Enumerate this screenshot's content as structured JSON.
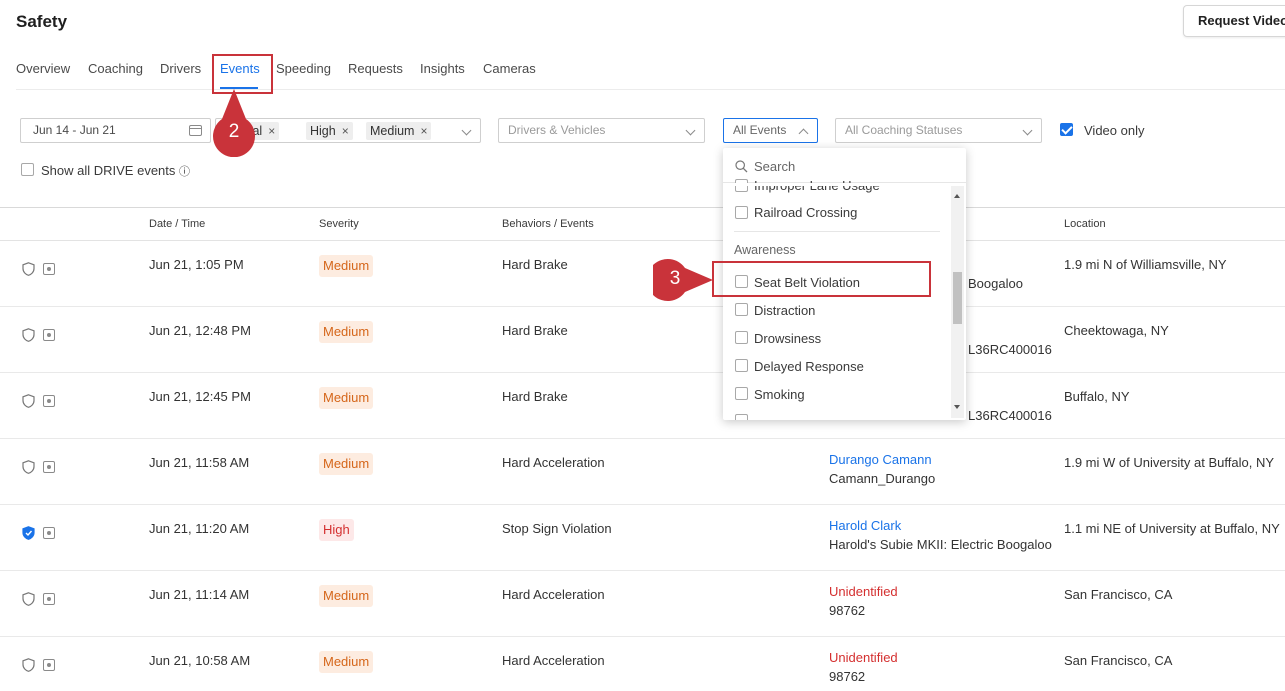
{
  "header": {
    "title": "Safety",
    "request_button": "Request Video"
  },
  "tabs": [
    {
      "label": "Overview",
      "active": false
    },
    {
      "label": "Coaching",
      "active": false
    },
    {
      "label": "Drivers",
      "active": false
    },
    {
      "label": "Events",
      "active": true
    },
    {
      "label": "Speeding",
      "active": false
    },
    {
      "label": "Requests",
      "active": false
    },
    {
      "label": "Insights",
      "active": false
    },
    {
      "label": "Cameras",
      "active": false
    }
  ],
  "annotations": {
    "step2": "2",
    "step3": "3",
    "color": "#c9333a"
  },
  "filters": {
    "date_range": "Jun 14 - Jun 21",
    "severity_chips": [
      "Critical",
      "High",
      "Medium"
    ],
    "chip_remove": "×",
    "drivers_vehicles_placeholder": "Drivers & Vehicles",
    "events_select": "All Events",
    "coaching_placeholder": "All Coaching Statuses",
    "video_only": {
      "label": "Video only",
      "checked": true
    },
    "show_drive": {
      "label": "Show all DRIVE events",
      "checked": false,
      "info": "ⓘ"
    }
  },
  "events_dropdown": {
    "search_placeholder": "Search",
    "items_before": [
      {
        "label": "Improper Lane Usage"
      },
      {
        "label": "Railroad Crossing"
      }
    ],
    "group": "Awareness",
    "items": [
      {
        "label": "Seat Belt Violation",
        "highlighted": true
      },
      {
        "label": "Distraction"
      },
      {
        "label": "Drowsiness"
      },
      {
        "label": "Delayed Response"
      },
      {
        "label": "Smoking"
      }
    ]
  },
  "table": {
    "headers": {
      "datetime": "Date / Time",
      "severity": "Severity",
      "behaviors": "Behaviors / Events",
      "location": "Location"
    },
    "rows": [
      {
        "datetime": "Jun 21, 1:05 PM",
        "severity": "Medium",
        "behavior": "Hard Brake",
        "driver": "",
        "vehicle": "Boogaloo",
        "location": "1.9 mi N of Williamsville, NY",
        "shield_filled": false
      },
      {
        "datetime": "Jun 21, 12:48 PM",
        "severity": "Medium",
        "behavior": "Hard Brake",
        "driver": "",
        "vehicle": "L36RC400016",
        "location": "Cheektowaga, NY",
        "shield_filled": false
      },
      {
        "datetime": "Jun 21, 12:45 PM",
        "severity": "Medium",
        "behavior": "Hard Brake",
        "driver": "",
        "vehicle": "L36RC400016",
        "location": "Buffalo, NY",
        "shield_filled": false
      },
      {
        "datetime": "Jun 21, 11:58 AM",
        "severity": "Medium",
        "behavior": "Hard Acceleration",
        "driver": "Durango Camann",
        "driver_type": "link",
        "vehicle": "Camann_Durango",
        "location": "1.9 mi W of University at Buffalo, NY",
        "shield_filled": false
      },
      {
        "datetime": "Jun 21, 11:20 AM",
        "severity": "High",
        "behavior": "Stop Sign Violation",
        "driver": "Harold Clark",
        "driver_type": "link",
        "vehicle": "Harold's Subie MKII: Electric Boogaloo",
        "location": "1.1 mi NE of University at Buffalo, NY",
        "shield_filled": true
      },
      {
        "datetime": "Jun 21, 11:14 AM",
        "severity": "Medium",
        "behavior": "Hard Acceleration",
        "driver": "Unidentified",
        "driver_type": "unknown",
        "vehicle": "98762",
        "location": "San Francisco, CA",
        "shield_filled": false
      },
      {
        "datetime": "Jun 21, 10:58 AM",
        "severity": "Medium",
        "behavior": "Hard Acceleration",
        "driver": "Unidentified",
        "driver_type": "unknown",
        "vehicle": "98762",
        "location": "San Francisco, CA",
        "shield_filled": false
      }
    ]
  }
}
